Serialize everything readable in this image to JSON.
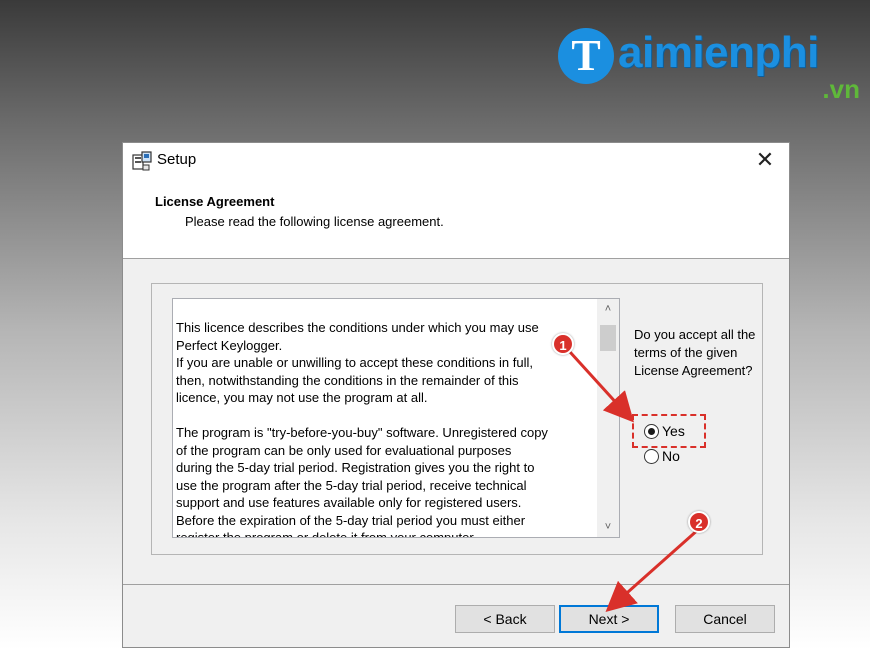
{
  "watermark": {
    "logo_letter": "T",
    "name": "aimienphi",
    "tld": ".vn",
    "brand_color": "#1b8fe0",
    "tld_color": "#5fb83a"
  },
  "window": {
    "title": "Setup",
    "icon": "setup-installer-icon",
    "close_glyph": "✕"
  },
  "header": {
    "title": "License Agreement",
    "subtitle": "Please read the following license agreement."
  },
  "license": {
    "text": "This licence describes the conditions under which you may use\nPerfect Keylogger.\nIf you are unable or unwilling to accept these conditions in full,\nthen, notwithstanding the conditions in the remainder of this\nlicence, you may not use the program at all.\n\nThe program is \"try-before-you-buy\" software. Unregistered copy\nof the program can be only used for evaluational purposes\nduring the 5-day trial period. Registration gives you the right to\nuse the program after the 5-day trial period, receive technical\nsupport and use features available only for registered users.\nBefore the expiration of the 5-day trial period you must either\nregister the program or delete it from your computer.",
    "scroll_up": "˄",
    "scroll_down": "˅"
  },
  "accept": {
    "question": "Do you accept all the terms of the given License Agreement?",
    "yes_label": "Yes",
    "no_label": "No",
    "selected": "Yes"
  },
  "buttons": {
    "back": "< Back",
    "next": "Next >",
    "cancel": "Cancel"
  },
  "annotations": {
    "step1": "1",
    "step2": "2",
    "color": "#d9302a"
  }
}
